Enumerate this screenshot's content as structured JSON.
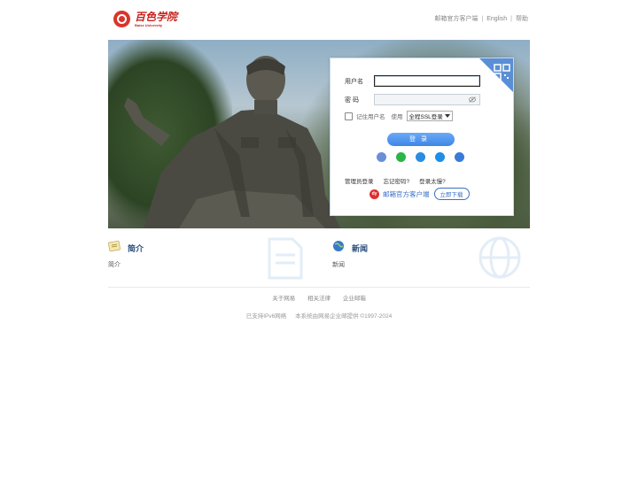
{
  "header": {
    "logo_cn": "百色学院",
    "logo_en": "Baise University",
    "links": [
      "邮箱官方客户端",
      "English",
      "帮助"
    ]
  },
  "login": {
    "username_label": "用户名",
    "password_label": "密 码",
    "remember_label": "记住用户名",
    "use_label": "使用",
    "ssl_option": "全程SSL登录",
    "submit_label": "登录",
    "links": [
      "管理员登录",
      "忘记密码?",
      "登录太慢?"
    ],
    "client_text": "邮箱官方客户端",
    "client_badge": "dy",
    "download_label": "立即下载",
    "social_icons": [
      "mail-icon",
      "wechat-icon",
      "qq-icon",
      "dingtalk-icon",
      "feishu-icon"
    ]
  },
  "sections": {
    "intro": {
      "title": "简介",
      "desc": "简介"
    },
    "news": {
      "title": "新闻",
      "desc": "新闻"
    }
  },
  "footer": {
    "links": [
      "关于网易",
      "相关法律",
      "企业邮箱"
    ],
    "ipv6": "已支持IPv6网络",
    "copyright": "本系统由网易企业邮提供 ©1997-2024"
  },
  "colors": {
    "accent": "#3d86e8",
    "brand_red": "#c8231c",
    "link_blue": "#3b6fc4"
  }
}
